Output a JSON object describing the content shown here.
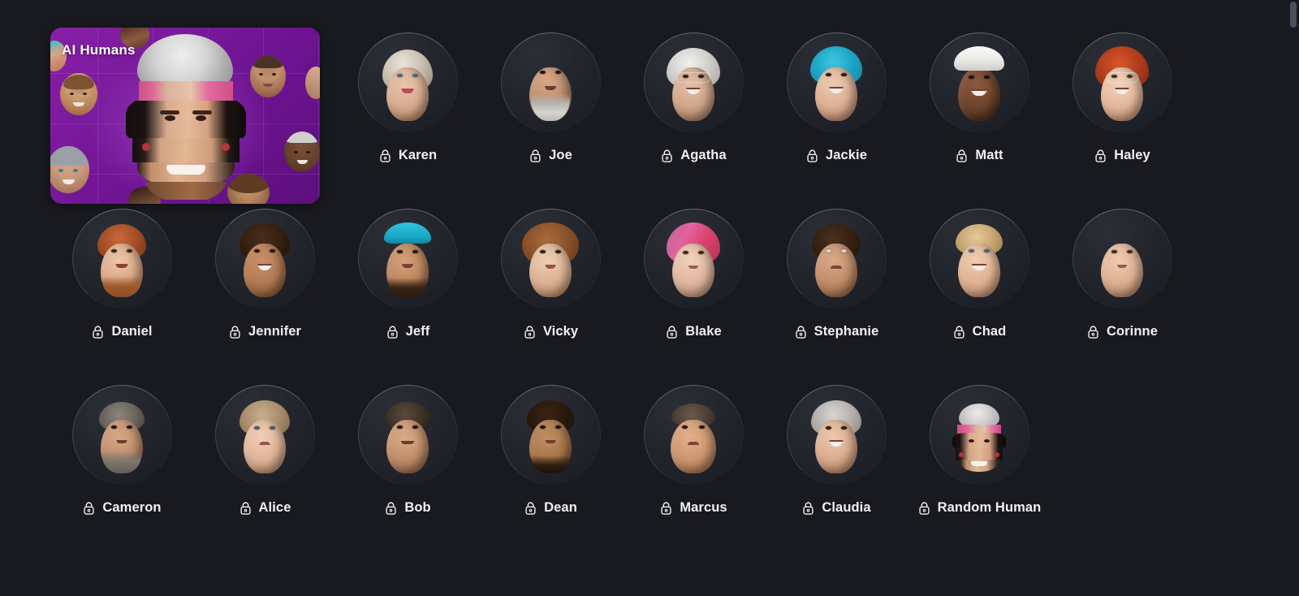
{
  "page": {
    "background_color": "#191a1f",
    "scrollbar": {
      "name": "vertical-scrollbar",
      "thumb_color": "#4b4f5d"
    }
  },
  "banner": {
    "title": "AI Humans",
    "accent_color": "#7a1a9c",
    "icon": "collage-face-image"
  },
  "grid": {
    "rows": [
      {
        "items": [
          {
            "name": "Karen",
            "lock": "lock-icon",
            "locked": true
          },
          {
            "name": "Joe",
            "lock": "lock-icon",
            "locked": true
          },
          {
            "name": "Agatha",
            "lock": "lock-icon",
            "locked": true
          },
          {
            "name": "Jackie",
            "lock": "lock-icon",
            "locked": true
          },
          {
            "name": "Matt",
            "lock": "lock-icon",
            "locked": true
          },
          {
            "name": "Haley",
            "lock": "lock-icon",
            "locked": true
          }
        ]
      },
      {
        "items": [
          {
            "name": "Daniel",
            "lock": "lock-icon",
            "locked": true
          },
          {
            "name": "Jennifer",
            "lock": "lock-icon",
            "locked": true
          },
          {
            "name": "Jeff",
            "lock": "lock-icon",
            "locked": true
          },
          {
            "name": "Vicky",
            "lock": "lock-icon",
            "locked": true
          },
          {
            "name": "Blake",
            "lock": "lock-icon",
            "locked": true
          },
          {
            "name": "Stephanie",
            "lock": "lock-icon",
            "locked": true
          },
          {
            "name": "Chad",
            "lock": "lock-icon",
            "locked": true
          },
          {
            "name": "Corinne",
            "lock": "lock-icon",
            "locked": true
          }
        ]
      },
      {
        "items": [
          {
            "name": "Cameron",
            "lock": "lock-icon",
            "locked": true
          },
          {
            "name": "Alice",
            "lock": "lock-icon",
            "locked": true
          },
          {
            "name": "Bob",
            "lock": "lock-icon",
            "locked": true
          },
          {
            "name": "Dean",
            "lock": "lock-icon",
            "locked": true
          },
          {
            "name": "Marcus",
            "lock": "lock-icon",
            "locked": true
          },
          {
            "name": "Claudia",
            "lock": "lock-icon",
            "locked": true
          },
          {
            "name": "Random Human",
            "lock": "lock-icon",
            "locked": true
          }
        ]
      }
    ]
  }
}
